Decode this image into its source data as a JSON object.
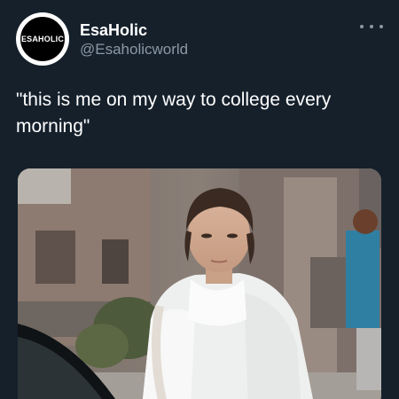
{
  "tweet": {
    "author": {
      "avatar_text": "ESAHOLIC",
      "display_name": "EsaHolic",
      "handle": "@Esaholicworld"
    },
    "more_icon": "more-horizontal-icon",
    "text": "\"this is me on my way to college every morning\"",
    "media": {
      "type": "photo"
    }
  },
  "colors": {
    "background": "#15202b",
    "text_primary": "#ffffff",
    "text_secondary": "#8b98a5"
  }
}
